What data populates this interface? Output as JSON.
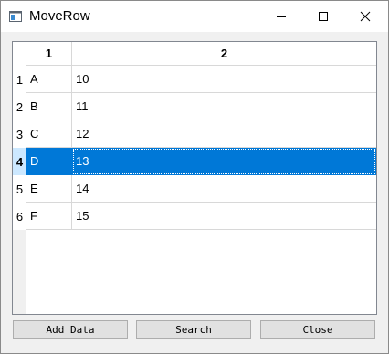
{
  "window": {
    "title": "MoveRow",
    "app_icon": "window-icon",
    "controls": [
      "minimize-icon",
      "maximize-icon",
      "close-icon"
    ]
  },
  "table": {
    "columns": [
      "1",
      "2"
    ],
    "rows": [
      {
        "header": "1",
        "cells": [
          "A",
          "10"
        ]
      },
      {
        "header": "2",
        "cells": [
          "B",
          "11"
        ]
      },
      {
        "header": "3",
        "cells": [
          "C",
          "12"
        ]
      },
      {
        "header": "4",
        "cells": [
          "D",
          "13"
        ]
      },
      {
        "header": "5",
        "cells": [
          "E",
          "14"
        ]
      },
      {
        "header": "6",
        "cells": [
          "F",
          "15"
        ]
      }
    ],
    "selected_row": "4",
    "selection_color": "#0078d7"
  },
  "buttons": {
    "add_data": "Add Data",
    "search": "Search",
    "close": "Close"
  }
}
